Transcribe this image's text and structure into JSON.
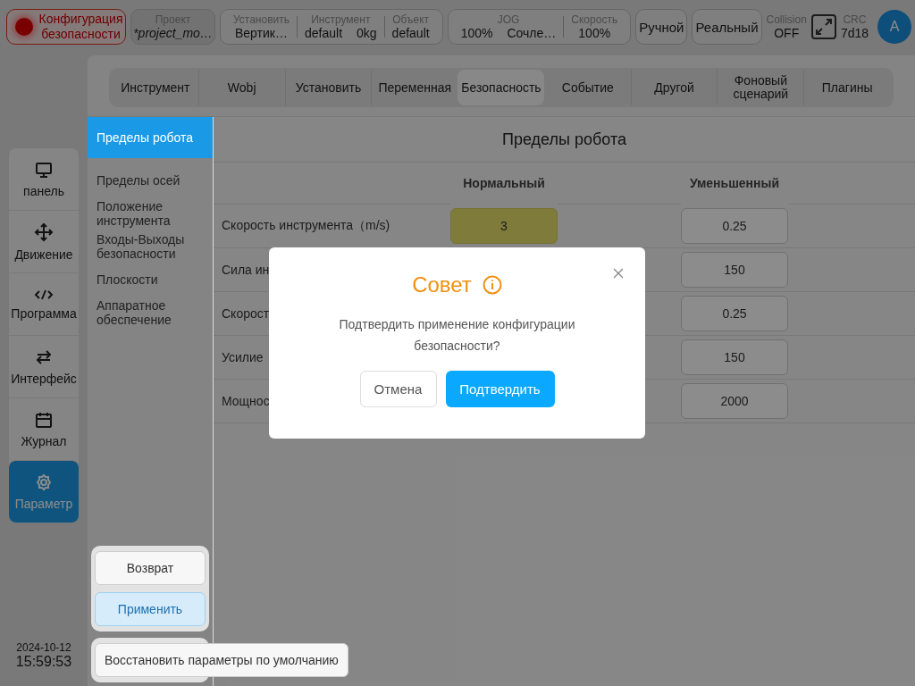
{
  "header": {
    "safety_config": "Конфигурация безопасности",
    "project": {
      "label": "Проект",
      "value": "*project_mo…"
    },
    "groups": [
      {
        "fields": [
          {
            "label": "Установить",
            "values": [
              "Вертик…"
            ]
          },
          {
            "label": "Инструмент",
            "values": [
              "default",
              "0kg"
            ]
          },
          {
            "label": "Объект",
            "values": [
              "default"
            ]
          }
        ]
      },
      {
        "fields": [
          {
            "label": "JOG",
            "values": [
              "100%",
              "Сочле…"
            ]
          },
          {
            "label": "Скорость",
            "values": [
              "100%"
            ]
          }
        ]
      }
    ],
    "mode_buttons": [
      "Ручной",
      "Реальный"
    ],
    "collision": {
      "label": "Collision",
      "value": "OFF"
    },
    "crc": {
      "label": "CRC",
      "value": "7d18"
    },
    "avatar": "A"
  },
  "nav": [
    {
      "label": "панель",
      "selected": false
    },
    {
      "label": "Движение",
      "selected": false
    },
    {
      "label": "Программа",
      "selected": false
    },
    {
      "label": "Интерфейс",
      "selected": false
    },
    {
      "label": "Журнал",
      "selected": false
    },
    {
      "label": "Параметр",
      "selected": true
    }
  ],
  "datetime": {
    "date": "2024-10-12",
    "time": "15:59:53"
  },
  "tabs": [
    {
      "label": "Инструмент",
      "selected": false
    },
    {
      "label": "Wobj",
      "selected": false
    },
    {
      "label": "Установить",
      "selected": false
    },
    {
      "label": "Переменная",
      "selected": false
    },
    {
      "label": "Безопасность",
      "selected": true
    },
    {
      "label": "Событие",
      "selected": false
    },
    {
      "label": "Другой",
      "selected": false
    },
    {
      "label": "Фоновый сценарий",
      "selected": false
    },
    {
      "label": "Плагины",
      "selected": false
    }
  ],
  "side_menu": [
    {
      "label": "Пределы робота",
      "selected": true
    },
    {
      "label": "Пределы осей",
      "selected": false
    },
    {
      "label": "Положение инструмента",
      "selected": false
    },
    {
      "label": "Входы-Выходы безопасности",
      "selected": false
    },
    {
      "label": "Плоскости",
      "selected": false
    },
    {
      "label": "Аппаратное обеспечение",
      "selected": false
    }
  ],
  "actions": {
    "back": "Возврат",
    "apply": "Применить",
    "restore": "Восстановить параметры по умолчанию"
  },
  "limits": {
    "title": "Пределы робота",
    "columns": [
      "Нормальный",
      "Уменьшенный"
    ],
    "rows": [
      {
        "label": "Скорость инструмента（m/s)",
        "normal": {
          "value": "3",
          "modified": true
        },
        "reduced": "0.25"
      },
      {
        "label": "Сила ин",
        "reduced": "150"
      },
      {
        "label": "Скорост",
        "reduced": "0.25"
      },
      {
        "label": "Усилие",
        "reduced": "150"
      },
      {
        "label": "Мощнос",
        "reduced": "2000"
      }
    ]
  },
  "dialog": {
    "title": "Совет",
    "message": "Подтвердить применение конфигурации безопасности?",
    "cancel": "Отмена",
    "confirm": "Подтвердить"
  }
}
